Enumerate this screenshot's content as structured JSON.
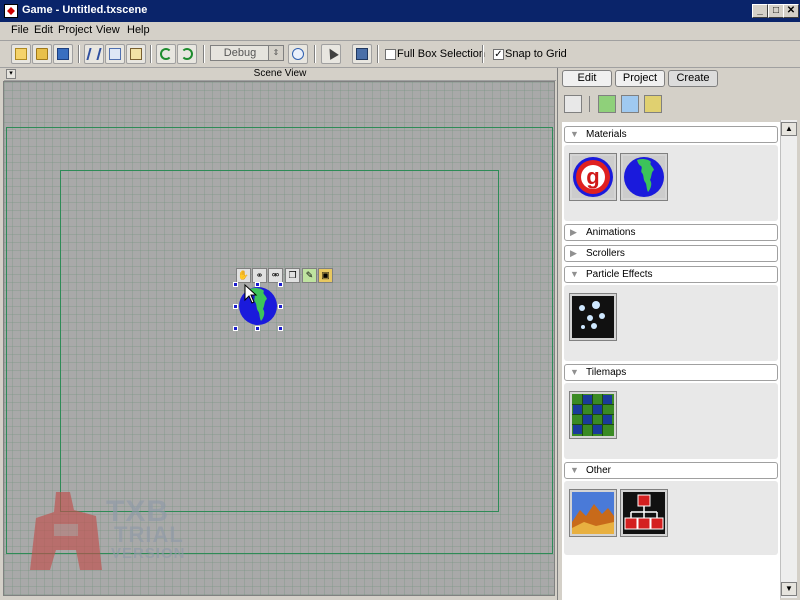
{
  "window": {
    "title": "Game - Untitled.txscene",
    "minimize": "_",
    "maximize": "□",
    "close": "✕"
  },
  "menu": [
    "File",
    "Edit",
    "Project",
    "View",
    "Help"
  ],
  "toolbar": {
    "config_value": "Debug",
    "full_box_selection_label": "Full Box Selection",
    "full_box_selection_checked": false,
    "snap_to_grid_label": "Snap to Grid",
    "snap_to_grid_checked": true,
    "check_mark": "✓"
  },
  "scene": {
    "title": "Scene View",
    "collapse_glyph": "▾",
    "sprite_tools": [
      "hand-icon",
      "link-icon",
      "unlink-icon",
      "copy-icon",
      "edit-icon",
      "image-icon"
    ]
  },
  "watermark": {
    "line1": "TXB",
    "line2": "TRIAL",
    "line3": "VERSION"
  },
  "panel": {
    "tabs": [
      "Edit",
      "Project",
      "Create"
    ],
    "active_tab": "Create",
    "sections": {
      "materials": "Materials",
      "animations": "Animations",
      "scrollers": "Scrollers",
      "particle_effects": "Particle Effects",
      "tilemaps": "Tilemaps",
      "other": "Other"
    },
    "collapsed_glyph": "▶",
    "expanded_glyph": "▼",
    "material_letter": "g"
  },
  "scroll": {
    "up": "▲",
    "down": "▼"
  },
  "colors": {
    "titlebar": "#0a246a",
    "scene_background": "#a9a9a9",
    "bounds_green": "#2e8b57",
    "globe_blue": "#1a1adc",
    "land_green": "#3cc45a",
    "watermark_red": "#c0504d"
  }
}
